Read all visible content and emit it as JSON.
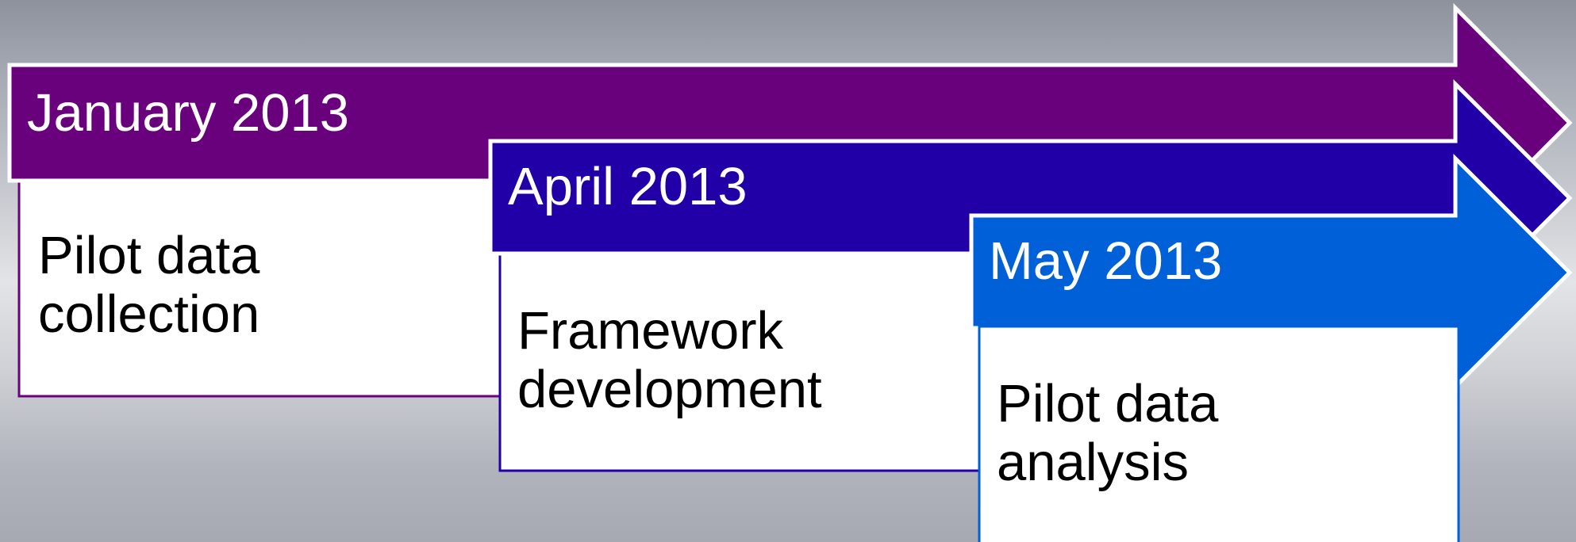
{
  "timeline": {
    "steps": [
      {
        "date": "January 2013",
        "description": "Pilot data collection",
        "color": "#69007c"
      },
      {
        "date": "April 2013",
        "description": "Framework development",
        "color": "#2100a8"
      },
      {
        "date": "May 2013",
        "description": "Pilot data analysis",
        "color": "#0060d8"
      }
    ]
  },
  "colors": {
    "box_fill": "#ffffff",
    "outline": "#ffffff",
    "label_text": "#ffffff",
    "body_text": "#000000"
  }
}
